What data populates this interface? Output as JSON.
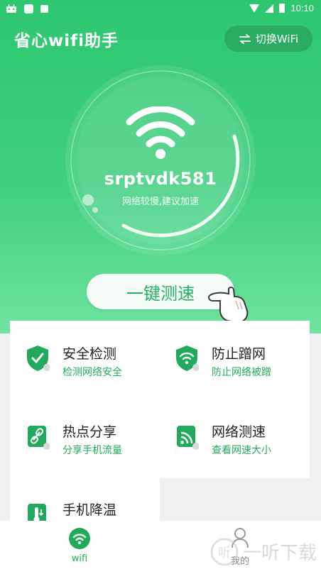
{
  "status_bar": {
    "time": "10:10"
  },
  "header": {
    "title": "省心wifi助手",
    "switch_button": "切换WiFi",
    "switch_icon": "swap-arrows-icon"
  },
  "wifi": {
    "ssid": "srptvdk581",
    "status": "网络较慢,建议加速",
    "icon": "wifi-icon"
  },
  "speed_test_button": "一键测速",
  "features": [
    {
      "title": "安全检测",
      "subtitle": "检测网络安全",
      "icon": "shield-check-icon"
    },
    {
      "title": "防止蹭网",
      "subtitle": "防止网络被蹭",
      "icon": "shield-wifi-icon"
    },
    {
      "title": "热点分享",
      "subtitle": "分享手机流量",
      "icon": "link-icon"
    },
    {
      "title": "网络测速",
      "subtitle": "查看网速大小",
      "icon": "rss-icon"
    },
    {
      "title": "手机降温",
      "subtitle": "",
      "icon": "thermometer-icon"
    }
  ],
  "bottom_nav": [
    {
      "label": "wifi",
      "icon": "wifi-icon"
    },
    {
      "label": "我的",
      "icon": "profile-icon"
    }
  ],
  "watermark": {
    "text": "一听下载"
  },
  "colors": {
    "primary": "#2dc76f",
    "accent_text": "#22aa5c"
  }
}
